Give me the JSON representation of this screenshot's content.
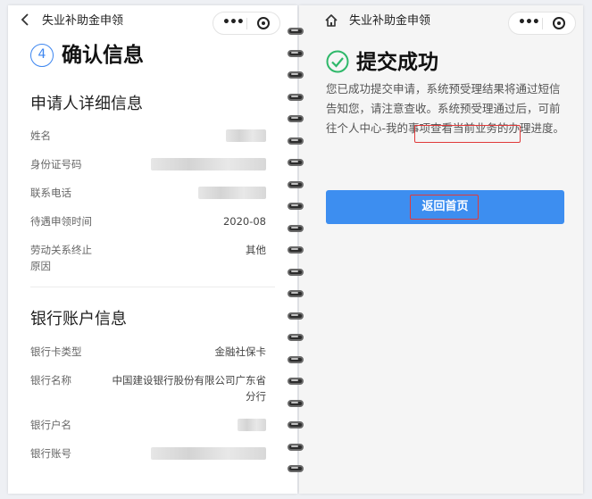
{
  "left": {
    "nav_title": "失业补助金申领",
    "step_number": "4",
    "heading": "确认信息",
    "applicant_section": "申请人详细信息",
    "rows": [
      {
        "label": "姓名",
        "value": ""
      },
      {
        "label": "身份证号码",
        "value": ""
      },
      {
        "label": "联系电话",
        "value": ""
      },
      {
        "label": "待遇申领时间",
        "value": "2020-08"
      },
      {
        "label": "劳动关系终止原因",
        "value": "其他"
      }
    ],
    "bank_section": "银行账户信息",
    "bank_rows": [
      {
        "label": "银行卡类型",
        "value": "金融社保卡"
      },
      {
        "label": "银行名称",
        "value": "中国建设银行股份有限公司广东省分行"
      },
      {
        "label": "银行户名",
        "value": ""
      },
      {
        "label": "银行账号",
        "value": ""
      }
    ]
  },
  "right": {
    "nav_title": "失业补助金申领",
    "heading": "提交成功",
    "desc_before": "您已成功提交申请，系统预受理结果将通过短信告知您，请注意查收。系统预受理通过后，可前往",
    "desc_highlight": "个人中心-我的事项",
    "desc_after": "查看当前业务的办理进度。",
    "home_button": "返回首页"
  },
  "colors": {
    "accent": "#3d8ef0",
    "success": "#2fb86a",
    "highlight_box": "#e03a3a"
  },
  "icons": {
    "back": "chevron-left-icon",
    "home": "home-icon",
    "more": "more-dots-icon",
    "close": "target-close-icon",
    "success": "check-circle-icon"
  }
}
